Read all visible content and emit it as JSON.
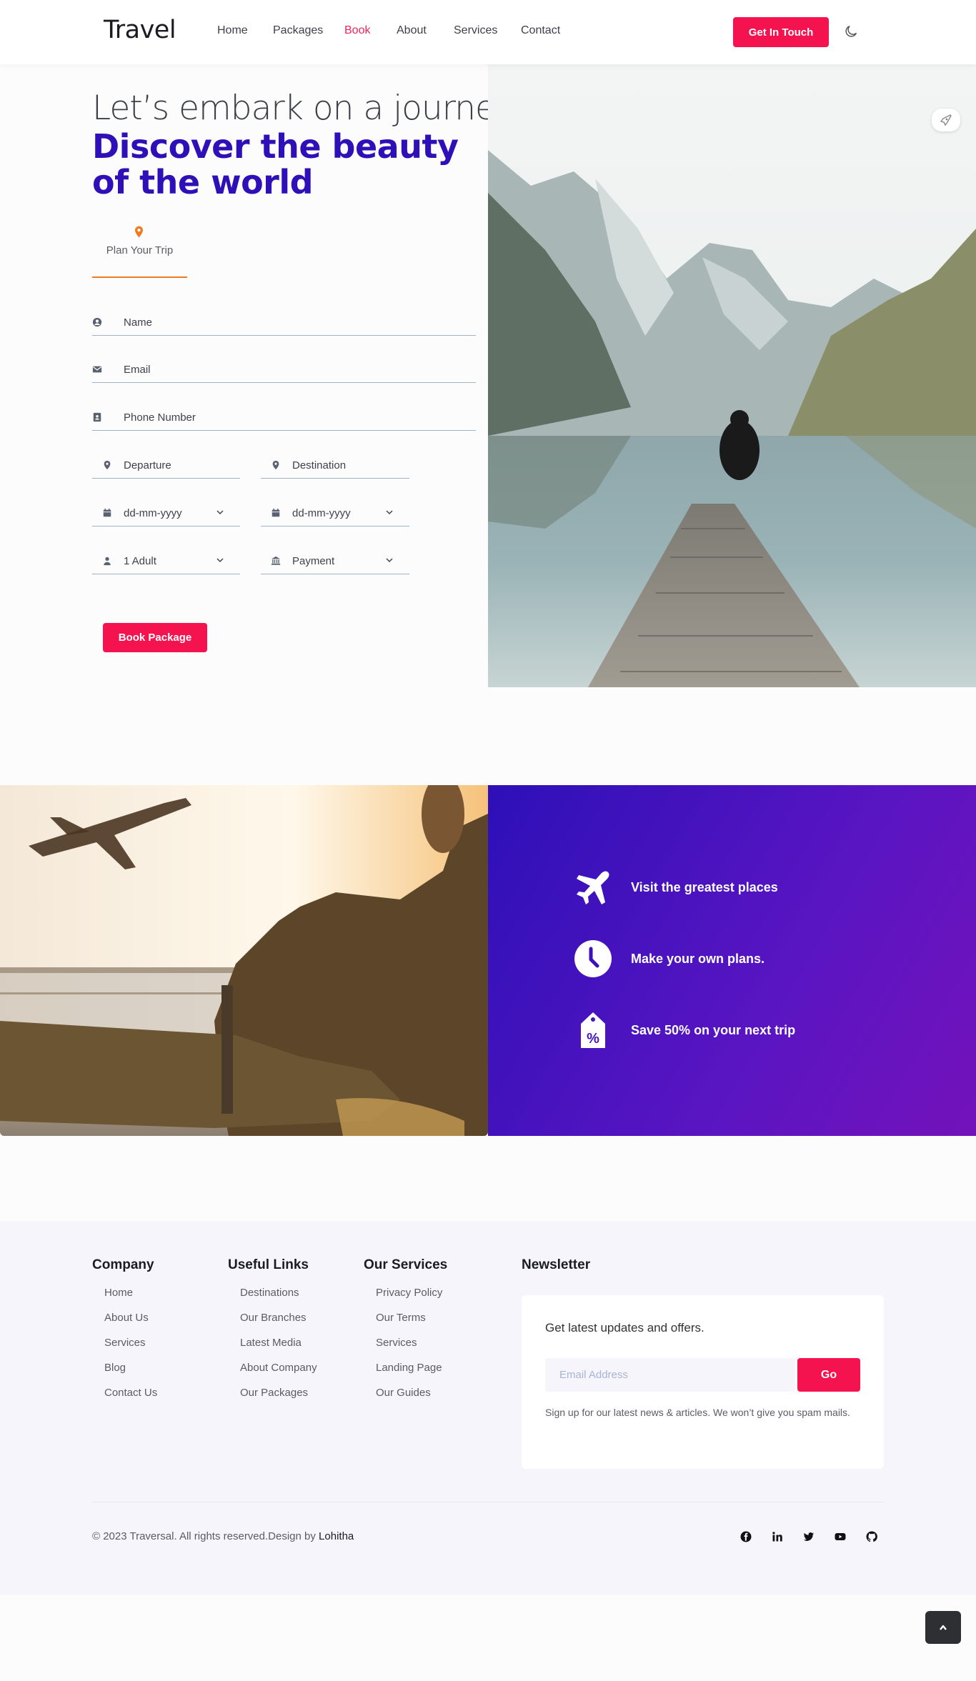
{
  "header": {
    "logo": "Travel",
    "nav": [
      "Home",
      "Packages",
      "Book",
      "About",
      "Services",
      "Contact"
    ],
    "active_nav": "Book",
    "cta_label": "Get In Touch",
    "theme_icon": "moon-icon"
  },
  "hero": {
    "heading_line1": "Let’s embark on a journey",
    "heading_line2": "Discover the beauty of the world",
    "tab_label": "Plan Your Trip",
    "fields": {
      "name": "Name",
      "email": "Email",
      "phone": "Phone Number",
      "departure": "Departure",
      "destination": "Destination",
      "date_from": "dd-mm-yyyy",
      "date_to": "dd-mm-yyyy",
      "travelers": "1 Adult",
      "payment": "Payment"
    },
    "submit_label": "Book Package",
    "accent_color": "#2f10b8"
  },
  "features": [
    {
      "icon": "plane-icon",
      "label": "Visit the greatest places"
    },
    {
      "icon": "clock-icon",
      "label": "Make your own plans."
    },
    {
      "icon": "discount-tag-icon",
      "label": "Save 50% on your next trip"
    }
  ],
  "footer": {
    "company": {
      "title": "Company",
      "links": [
        "Home",
        "About Us",
        "Services",
        "Blog",
        "Contact Us"
      ]
    },
    "useful": {
      "title": "Useful Links",
      "links": [
        "Destinations",
        "Our Branches",
        "Latest Media",
        "About Company",
        "Our Packages"
      ]
    },
    "services": {
      "title": "Our Services",
      "links": [
        "Privacy Policy",
        "Our Terms",
        "Services",
        "Landing Page",
        "Our Guides"
      ]
    },
    "newsletter": {
      "title": "Newsletter",
      "tagline": "Get latest updates and offers.",
      "email_placeholder": "Email Address",
      "go_label": "Go",
      "note": "Sign up for our latest news & articles. We won’t give you spam mails."
    },
    "copyright": "© 2023 Traversal. All rights reserved.Design by",
    "author": "Lohitha",
    "socials": [
      "facebook-icon",
      "linkedin-icon",
      "twitter-icon",
      "youtube-icon",
      "github-icon"
    ]
  },
  "colors": {
    "brand": "#f5134f",
    "primary": "#2f10b8",
    "tab_accent": "#f07a1e"
  }
}
